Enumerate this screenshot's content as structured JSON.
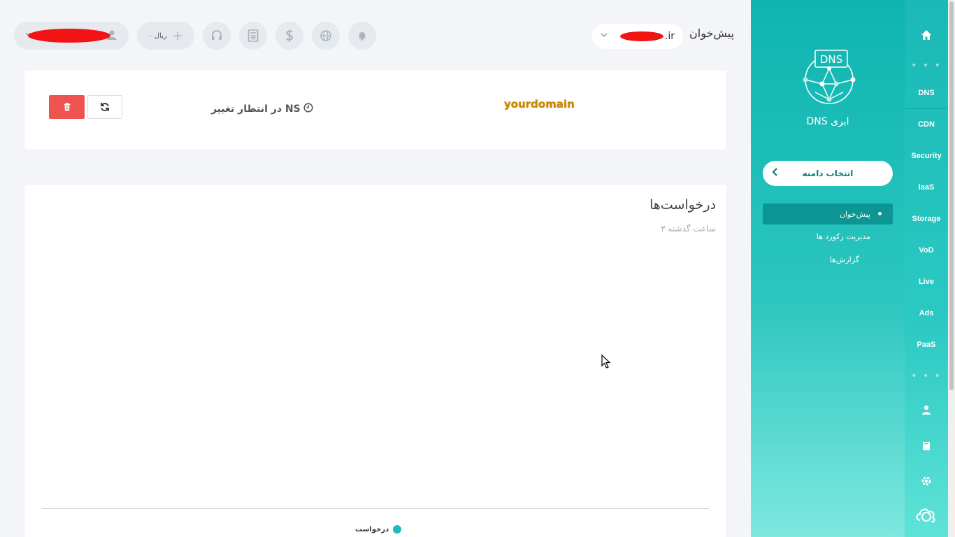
{
  "rail": {
    "items": [
      {
        "label": "DNS",
        "active": true
      },
      {
        "label": "CDN"
      },
      {
        "label": "Security"
      },
      {
        "label": "IaaS"
      },
      {
        "label": "Storage"
      },
      {
        "label": "VoD"
      },
      {
        "label": "Live"
      },
      {
        "label": "Ads"
      },
      {
        "label": "PaaS"
      }
    ],
    "dots": "• • •"
  },
  "sidebar": {
    "title": "DNS ابری",
    "logo_text": "DNS",
    "domain_select_label": "انتخاب دامنه",
    "menu": [
      {
        "label": "پیش‌خوان",
        "active": true
      },
      {
        "label": "مدیریت رکورد ها"
      },
      {
        "label": "گزارش‌ها"
      }
    ]
  },
  "topbar": {
    "title": "پیش‌خوان",
    "domain_suffix": ".ir",
    "wallet": "۰ ریال"
  },
  "domain_card": {
    "domain": "yourdomain",
    "status": "در انتظار تغییر NS"
  },
  "requests": {
    "title": "درخواست‌ها",
    "subtitle": "۳ ساعت گذشته",
    "legend": "درخواست",
    "colors": {
      "series": "#1bbcb6"
    }
  },
  "colors": {
    "accent": "#1ab9b7",
    "danger": "#ef5350"
  }
}
